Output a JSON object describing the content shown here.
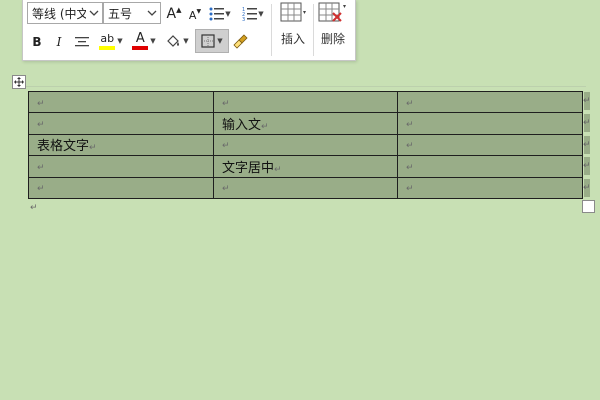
{
  "toolbar": {
    "font_name": "等线 (中文",
    "font_size": "五号",
    "grow_font": "A",
    "shrink_font": "A",
    "bold": "B",
    "italic": "I",
    "highlight": "ab",
    "font_color": "A",
    "insert_label": "插入",
    "delete_label": "删除"
  },
  "table": {
    "paragraph_mark": "↵",
    "rows": [
      [
        "",
        "",
        ""
      ],
      [
        "",
        "输入文",
        ""
      ],
      [
        "表格文字",
        "",
        ""
      ],
      [
        "",
        "文字居中",
        ""
      ],
      [
        "",
        "",
        ""
      ]
    ]
  },
  "colors": {
    "background": "#c8e0b4",
    "cell_shading": "#99ad88",
    "highlight_yellow": "#ffff00",
    "font_red": "#e00000"
  }
}
